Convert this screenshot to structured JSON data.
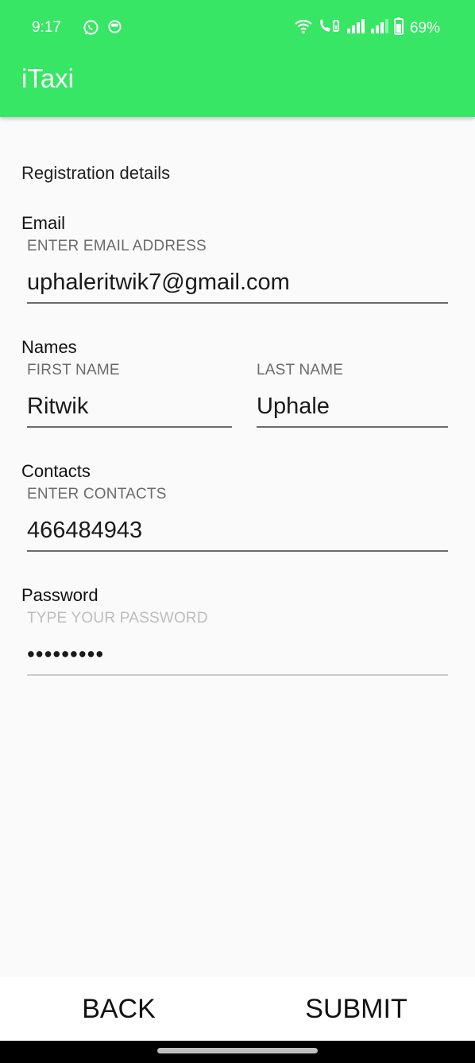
{
  "status_bar": {
    "time": "9:17",
    "battery": "69%",
    "icons": [
      "whatsapp-icon",
      "notification-icon",
      "wifi-icon",
      "wifi-calling-icon",
      "signal-icon",
      "signal-icon",
      "battery-icon"
    ]
  },
  "app_bar": {
    "title": "iTaxi",
    "color": "#37e664"
  },
  "form": {
    "heading": "Registration details",
    "email": {
      "label": "Email",
      "hint": "ENTER EMAIL ADDRESS",
      "value": "uphaleritwik7@gmail.com"
    },
    "names": {
      "label": "Names",
      "first": {
        "hint": "FIRST NAME",
        "value": "Ritwik"
      },
      "last": {
        "hint": "LAST NAME",
        "value": "Uphale"
      }
    },
    "contacts": {
      "label": "Contacts",
      "hint": "ENTER CONTACTS",
      "value": "466484943"
    },
    "password": {
      "label": "Password",
      "hint": "TYPE YOUR PASSWORD",
      "value": "•••••••••"
    }
  },
  "actions": {
    "back": "BACK",
    "submit": "SUBMIT"
  }
}
